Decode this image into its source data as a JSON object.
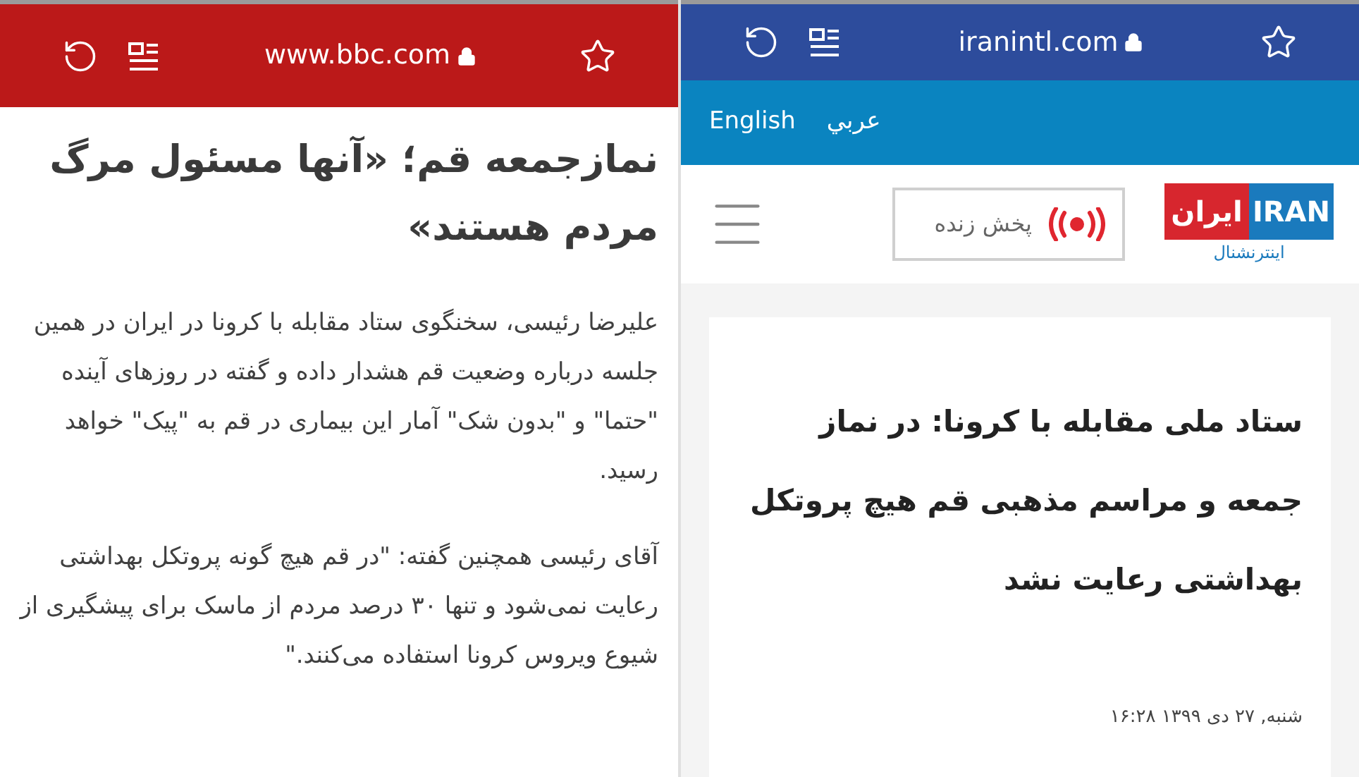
{
  "left_browser": {
    "address_bar": {
      "url": "www.bbc.com"
    },
    "article": {
      "headline": "نمازجمعه قم؛ «آنها مسئول مرگ مردم هستند»",
      "paragraphs": [
        "علیرضا رئیسی، سخنگوی ستاد مقابله با کرونا در ایران در همین جلسه درباره وضعیت قم هشدار داده و گفته در روزهای آینده \"حتما\" و \"بدون شک\" آمار این بیماری در قم به \"پیک\" خواهد رسید.",
        "آقای رئیسی همچنین گفته: \"در قم هیچ گونه پروتکل بهداشتی رعایت نمی‌شود و تنها ۳۰ درصد مردم از ماسک برای پیشگیری از شیوع ویروس کرونا استفاده می‌کنند.\""
      ]
    }
  },
  "right_browser": {
    "address_bar": {
      "url": "iranintl.com"
    },
    "language_links": [
      "عربي",
      "English"
    ],
    "live_button": {
      "label": "پخش زنده"
    },
    "logo": {
      "latin": "IRAN",
      "persian": "ایران",
      "subtitle": "اینترنشنال"
    },
    "article": {
      "headline": "ستاد ملی مقابله با کرونا: در نماز جمعه و مراسم مذهبی قم هیچ پروتکل بهداشتی رعایت نشد",
      "date": "شنبه, ۲۷ دی ۱۳۹۹ ۱۶:۲۸"
    }
  }
}
